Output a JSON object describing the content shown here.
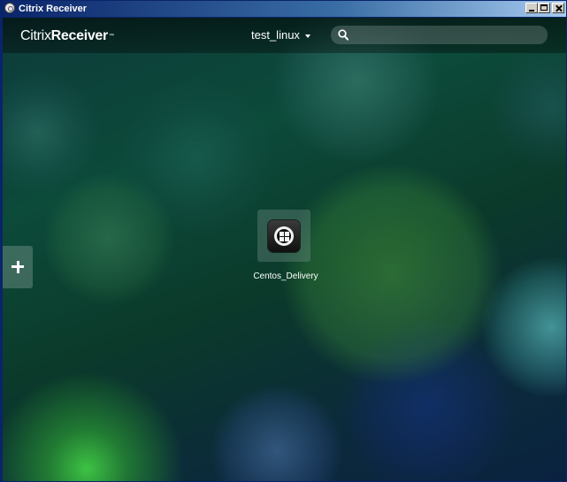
{
  "window": {
    "title": "Citrix Receiver"
  },
  "header": {
    "logo_light": "Citrix",
    "logo_bold": "Receiver",
    "logo_tm": "™",
    "user_name": "test_linux",
    "search": {
      "value": "",
      "placeholder": ""
    }
  },
  "apps": [
    {
      "name": "Centos_Delivery",
      "icon": "windows-app-icon"
    }
  ],
  "icons": {
    "window_icon": "citrix-receiver-icon",
    "search": "search-icon",
    "add": "plus-icon",
    "user_menu_caret": "chevron-down-icon"
  }
}
